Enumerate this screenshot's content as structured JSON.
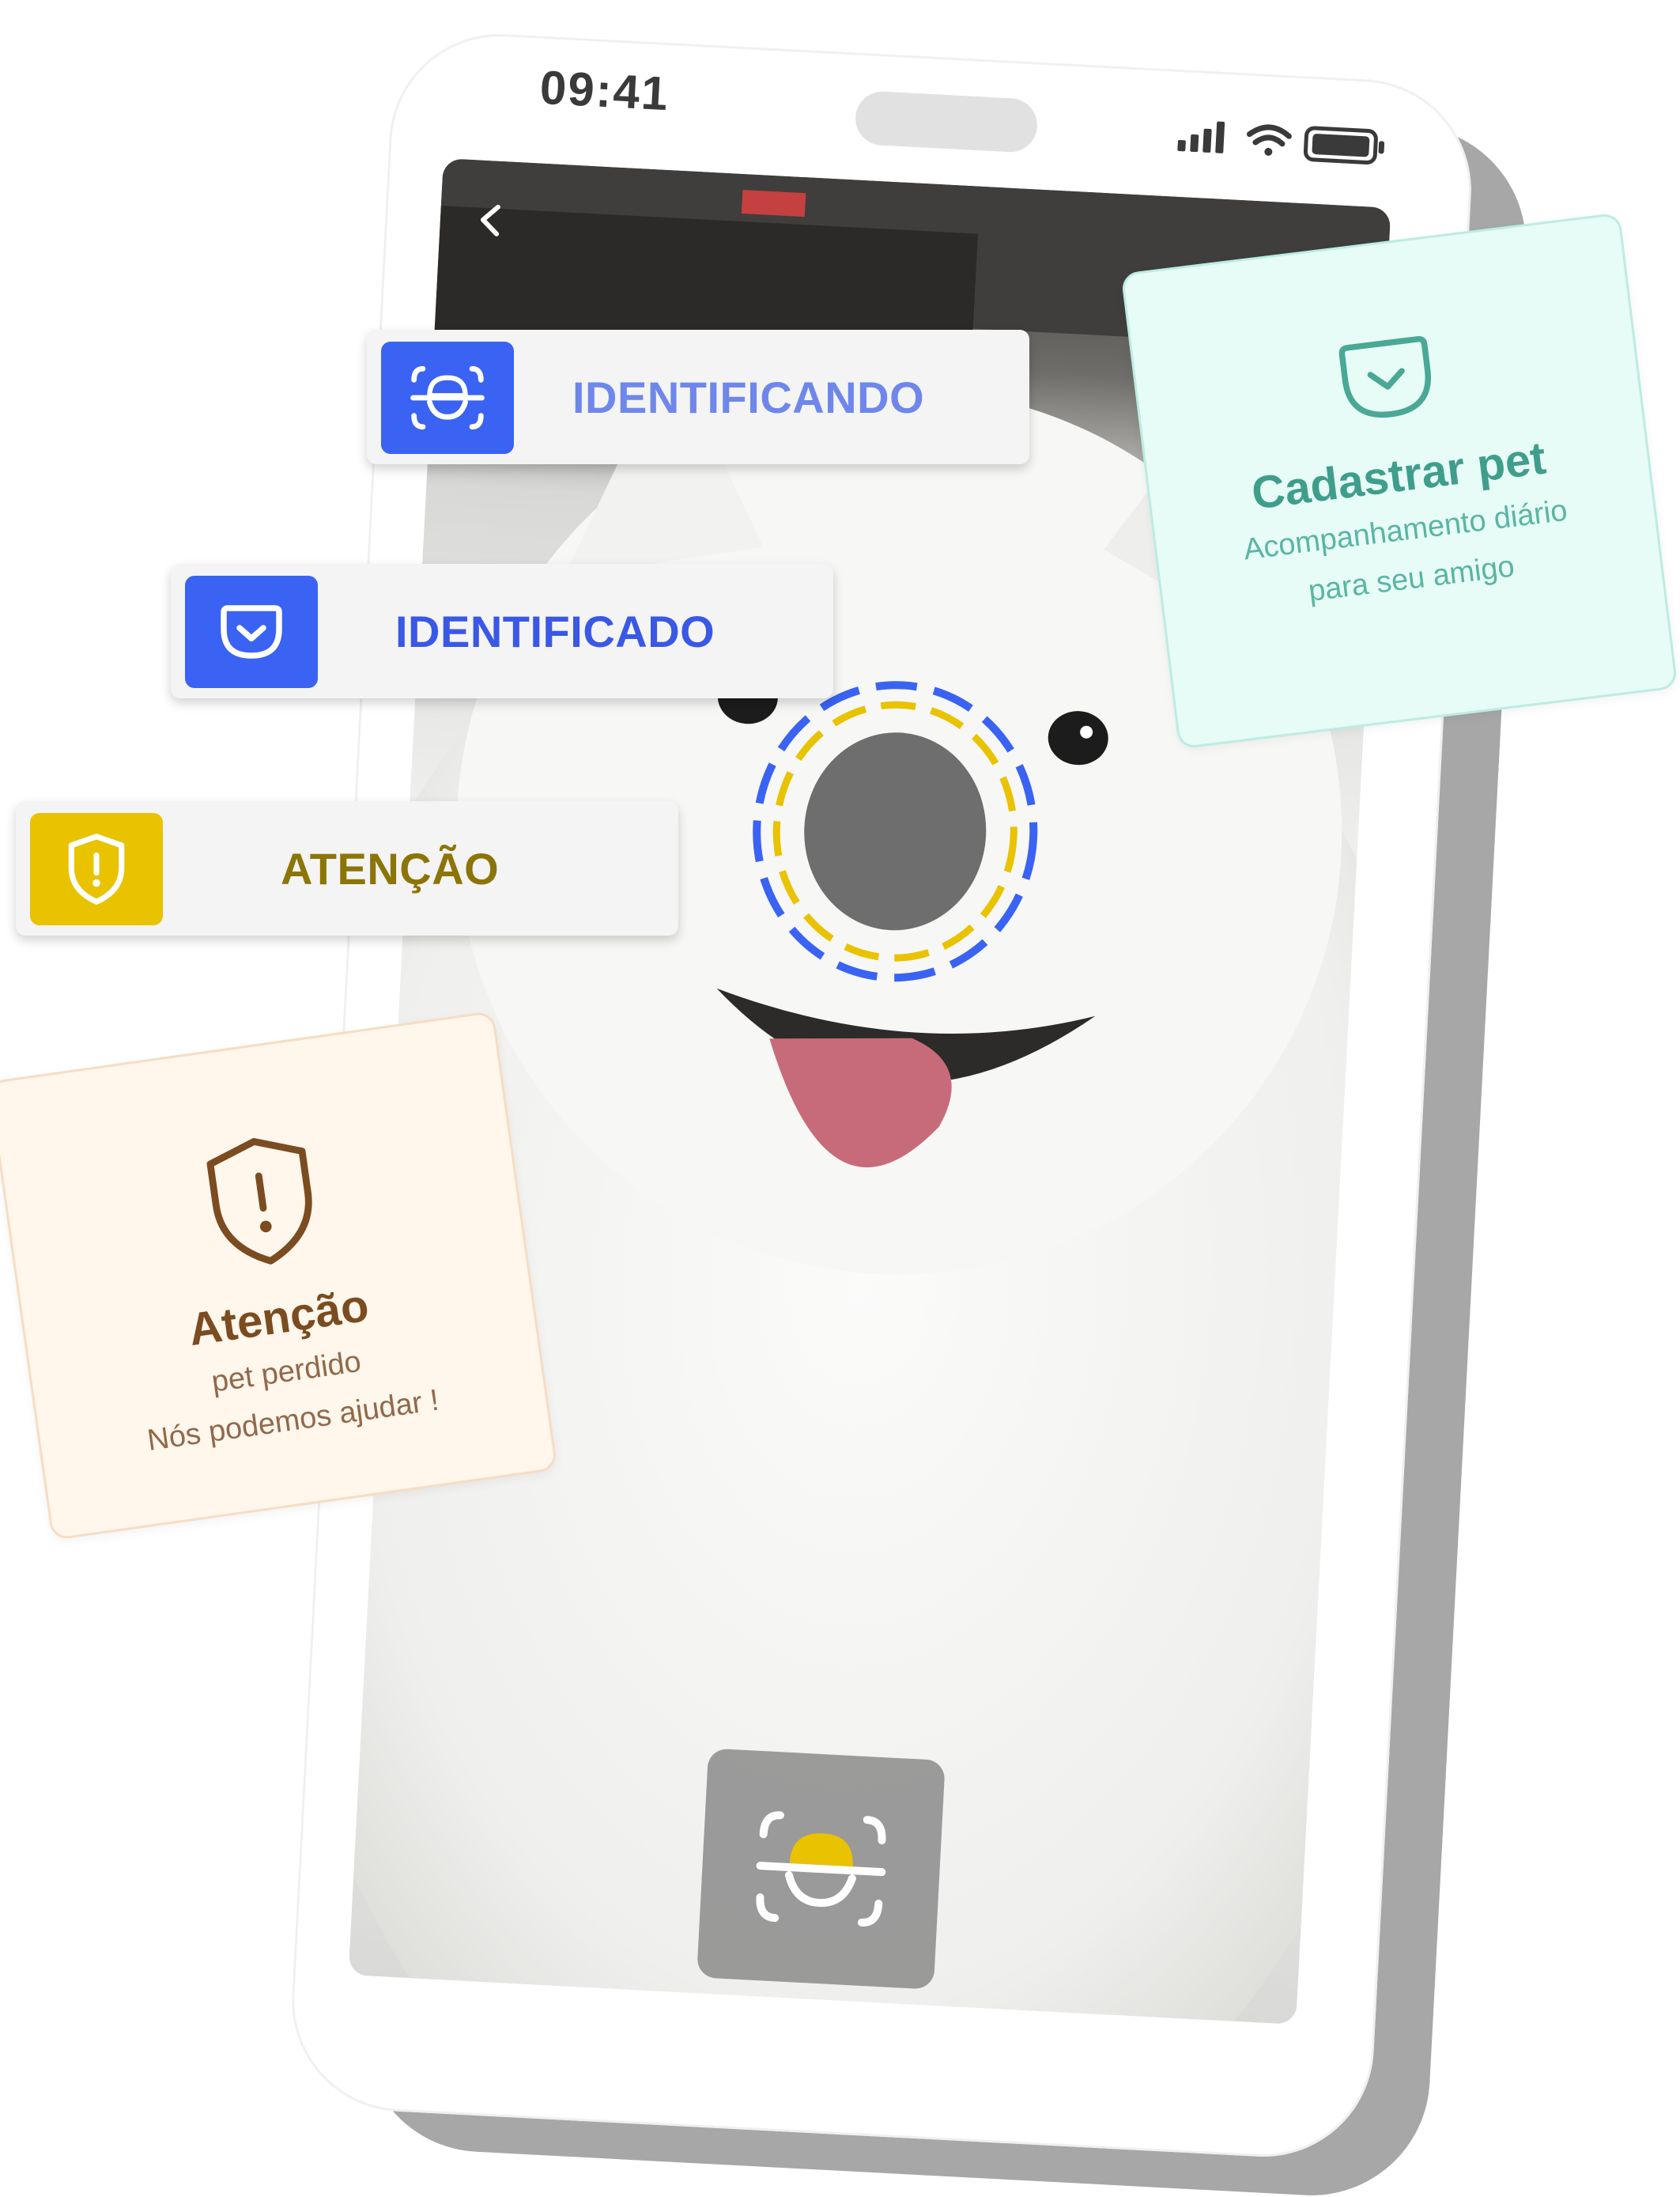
{
  "status_bar": {
    "time": "09:41",
    "icons": [
      "cellular-signal-icon",
      "wifi-icon",
      "battery-icon"
    ]
  },
  "camera": {
    "back_icon": "chevron-left-icon",
    "capture_icon": "nose-scan-icon",
    "scan_ring_colors": [
      "#3a63f3",
      "#e9c200"
    ]
  },
  "pills": {
    "identifying": {
      "label": "IDENTIFICANDO",
      "icon": "nose-scan-icon",
      "color": "#3a63f3"
    },
    "identified": {
      "label": "IDENTIFICADO",
      "icon": "pocket-check-icon",
      "color": "#3a63f3"
    },
    "attention": {
      "label": "ATENÇÃO",
      "icon": "shield-alert-icon",
      "color": "#e9c200"
    }
  },
  "cards": {
    "register": {
      "title": "Cadastrar pet",
      "line1": "Acompanhamento diário",
      "line2": "para seu amigo",
      "icon": "pocket-check-icon",
      "color": "#3f9e8b"
    },
    "lost": {
      "title": "Atenção",
      "line1": "pet perdido",
      "line2": "Nós podemos ajudar !",
      "icon": "shield-alert-icon",
      "color": "#7a4c20"
    }
  }
}
